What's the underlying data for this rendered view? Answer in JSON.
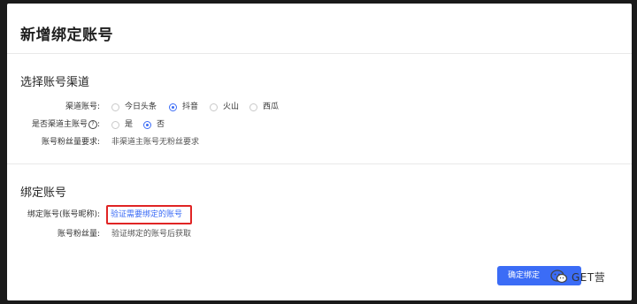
{
  "dialog": {
    "title": "新增绑定账号"
  },
  "channel_section": {
    "title": "选择账号渠道",
    "channel_label": "渠道账号:",
    "channel_options": [
      "今日头条",
      "抖音",
      "火山",
      "西瓜"
    ],
    "channel_selected": "抖音",
    "main_account_label": "是否渠道主账号",
    "main_account_options": [
      "是",
      "否"
    ],
    "main_account_selected": "否",
    "fans_req_label": "账号粉丝量要求:",
    "fans_req_value": "非渠道主账号无粉丝要求"
  },
  "bind_section": {
    "title": "绑定账号",
    "bind_label": "绑定账号(账号昵称):",
    "verify_link": "验证需要绑定的账号",
    "fans_label": "账号粉丝量:",
    "fans_value": "验证绑定的账号后获取"
  },
  "footer": {
    "confirm_button": "确定绑定"
  },
  "watermark": {
    "text": "GET营"
  },
  "colors": {
    "primary": "#3b6cf6",
    "highlight": "#e02424"
  }
}
